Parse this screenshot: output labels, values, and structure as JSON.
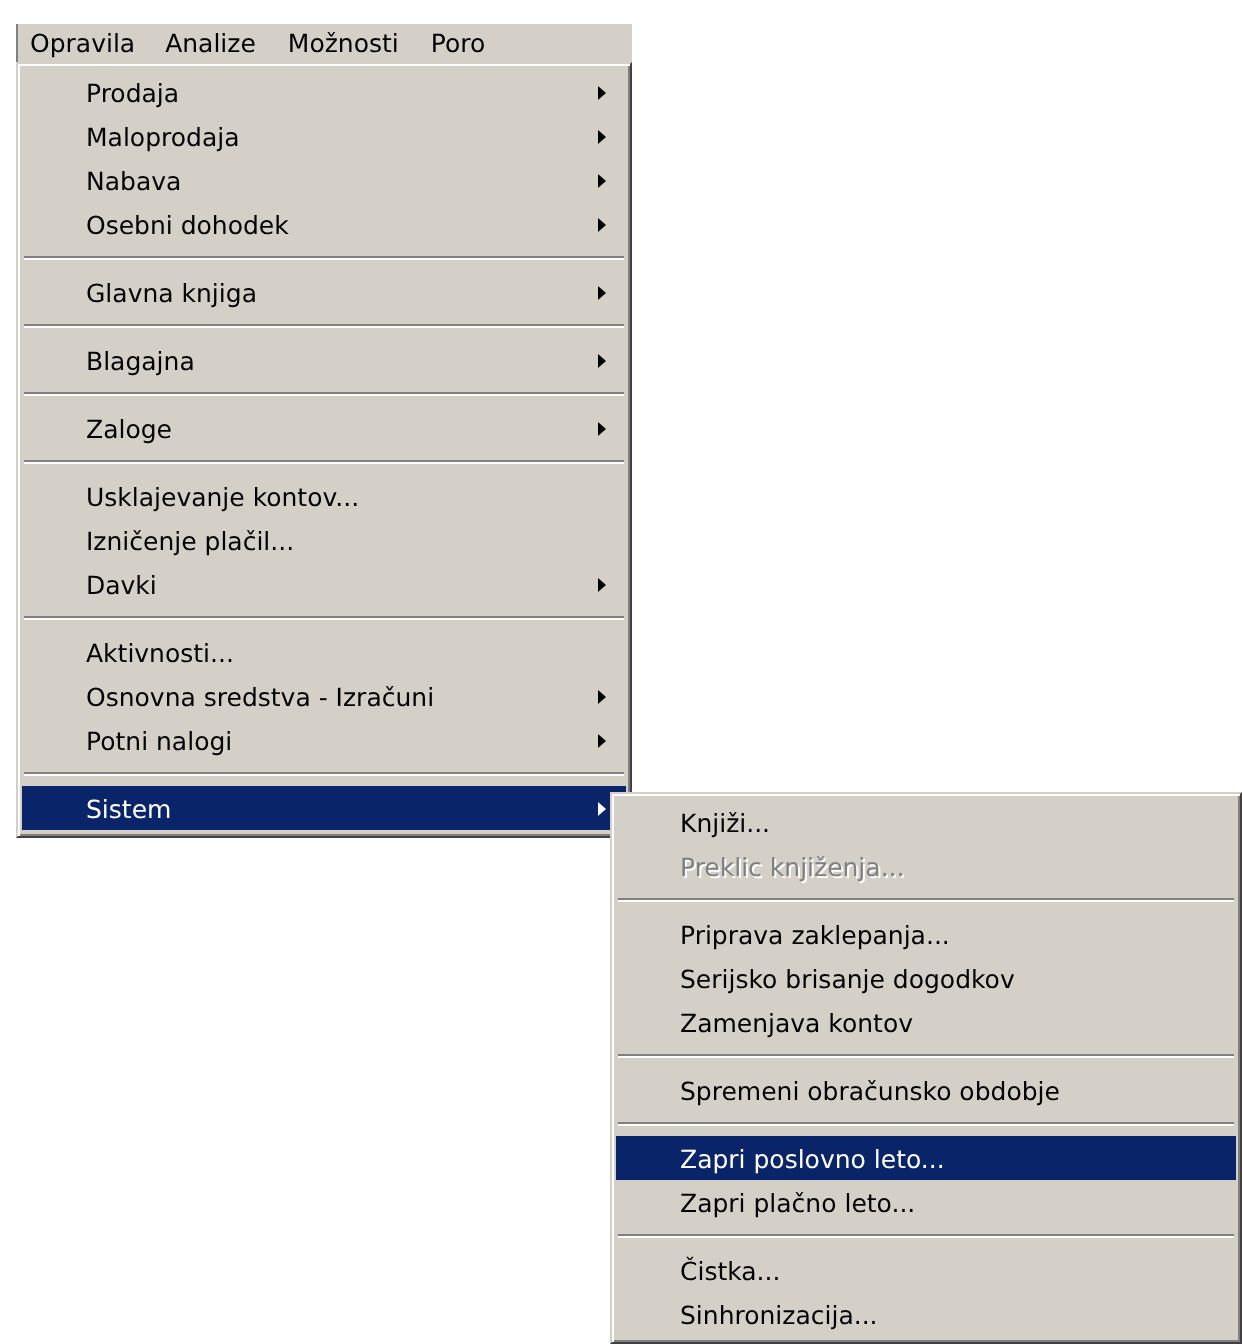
{
  "menubar": [
    {
      "label": "Opravila",
      "selected": true
    },
    {
      "label": "Analize",
      "selected": false
    },
    {
      "label": "Možnosti",
      "selected": false
    },
    {
      "label": "Poro",
      "selected": false
    }
  ],
  "menu": {
    "groups": [
      [
        {
          "label": "Prodaja",
          "submenu": true,
          "selected": false,
          "disabled": false
        },
        {
          "label": "Maloprodaja",
          "submenu": true,
          "selected": false,
          "disabled": false
        },
        {
          "label": "Nabava",
          "submenu": true,
          "selected": false,
          "disabled": false
        },
        {
          "label": "Osebni dohodek",
          "submenu": true,
          "selected": false,
          "disabled": false
        }
      ],
      [
        {
          "label": "Glavna knjiga",
          "submenu": true,
          "selected": false,
          "disabled": false
        }
      ],
      [
        {
          "label": "Blagajna",
          "submenu": true,
          "selected": false,
          "disabled": false
        }
      ],
      [
        {
          "label": "Zaloge",
          "submenu": true,
          "selected": false,
          "disabled": false
        }
      ],
      [
        {
          "label": "Usklajevanje kontov...",
          "submenu": false,
          "selected": false,
          "disabled": false
        },
        {
          "label": "Izničenje plačil...",
          "submenu": false,
          "selected": false,
          "disabled": false
        },
        {
          "label": "Davki",
          "submenu": true,
          "selected": false,
          "disabled": false
        }
      ],
      [
        {
          "label": "Aktivnosti...",
          "submenu": false,
          "selected": false,
          "disabled": false
        },
        {
          "label": "Osnovna sredstva - Izračuni",
          "submenu": true,
          "selected": false,
          "disabled": false
        },
        {
          "label": "Potni nalogi",
          "submenu": true,
          "selected": false,
          "disabled": false
        }
      ],
      [
        {
          "label": "Sistem",
          "submenu": true,
          "selected": true,
          "disabled": false
        }
      ]
    ]
  },
  "submenu": {
    "groups": [
      [
        {
          "label": "Knjiži...",
          "submenu": false,
          "selected": false,
          "disabled": false
        },
        {
          "label": "Preklic knjiženja...",
          "submenu": false,
          "selected": false,
          "disabled": true
        }
      ],
      [
        {
          "label": "Priprava zaklepanja...",
          "submenu": false,
          "selected": false,
          "disabled": false
        },
        {
          "label": "Serijsko brisanje dogodkov",
          "submenu": false,
          "selected": false,
          "disabled": false
        },
        {
          "label": "Zamenjava kontov",
          "submenu": false,
          "selected": false,
          "disabled": false
        }
      ],
      [
        {
          "label": "Spremeni obračunsko obdobje",
          "submenu": false,
          "selected": false,
          "disabled": false
        }
      ],
      [
        {
          "label": "Zapri poslovno leto...",
          "submenu": false,
          "selected": true,
          "disabled": false
        },
        {
          "label": "Zapri plačno leto...",
          "submenu": false,
          "selected": false,
          "disabled": false
        }
      ],
      [
        {
          "label": "Čistka...",
          "submenu": false,
          "selected": false,
          "disabled": false
        },
        {
          "label": "Sinhronizacija...",
          "submenu": false,
          "selected": false,
          "disabled": false
        }
      ]
    ]
  }
}
